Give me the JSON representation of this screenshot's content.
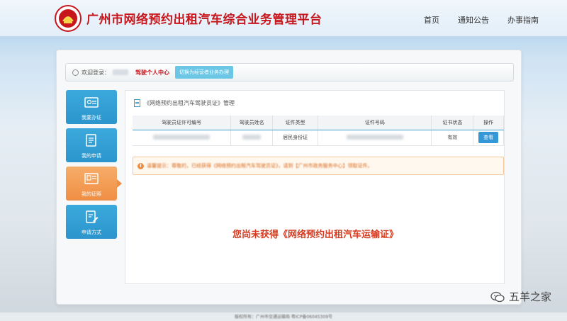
{
  "header": {
    "site_title": "广州市网络预约出租汽车综合业务管理平台",
    "logo_icon": "emblem-icon",
    "nav": [
      "首页",
      "通知公告",
      "办事指南"
    ]
  },
  "welcome_bar": {
    "welcome_label": "欢迎登录：",
    "personal_center": "驾驶个人中心",
    "switch_button": "切换为经营者业务办理"
  },
  "sidebar": {
    "items": [
      {
        "label": "我要办证",
        "icon": "id-card-icon",
        "active": false
      },
      {
        "label": "我的申请",
        "icon": "document-icon",
        "active": false
      },
      {
        "label": "我的证照",
        "icon": "certificate-icon",
        "active": true
      },
      {
        "label": "申请方式",
        "icon": "form-edit-icon",
        "active": false
      }
    ]
  },
  "content": {
    "section_title": "《网络预约出租汽车驾驶员证》管理",
    "table": {
      "headers": [
        "驾驶员证许可编号",
        "驾驶员姓名",
        "证件类型",
        "证件号码",
        "证书状态",
        "操作"
      ],
      "rows": [
        {
          "permit_no": "",
          "name": "",
          "id_type": "居民身份证",
          "id_no": "",
          "status": "有效",
          "action": "查看"
        }
      ]
    },
    "notice": "温馨提示：尊敬的，已经获得《网络预约出租汽车驾驶员证》，请到【广州市政务服务中心】领取证件。",
    "empty_message": "您尚未获得《网络预约出租汽车运输证》"
  },
  "watermark": {
    "text": "五羊之家"
  },
  "footer": {
    "text": "版权所有：广州市交通运输局 粤ICP备06045309号"
  },
  "colors": {
    "brand_red": "#c8161d",
    "sidebar_blue": "#2b95cc",
    "sidebar_active_orange": "#f08e43",
    "button_blue": "#3598d6"
  }
}
